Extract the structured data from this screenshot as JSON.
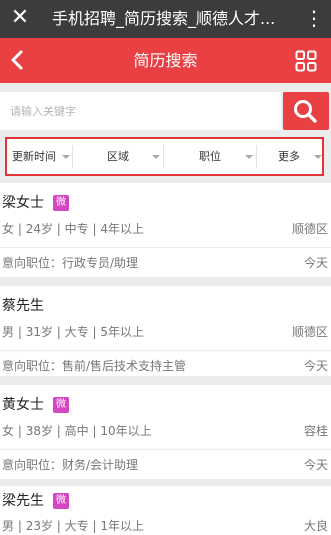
{
  "titlebar": {
    "close_icon": "close-icon",
    "title": "手机招聘_简历搜索_顺德人才...",
    "more_icon": "more-vertical-icon"
  },
  "header": {
    "back_icon": "chevron-left-icon",
    "title": "简历搜索",
    "grid_icon": "grid-icon"
  },
  "search": {
    "placeholder": "请输入关键字",
    "button_icon": "search-icon"
  },
  "filters": [
    {
      "label": "更新时间"
    },
    {
      "label": "区域"
    },
    {
      "label": "职位"
    },
    {
      "label": "更多"
    }
  ],
  "resumes": [
    {
      "name": "梁女士",
      "badge": "微",
      "gender": "女",
      "age": "24岁",
      "education": "中专",
      "experience": "4年以上",
      "location": "顺德区",
      "position": "意向职位：行政专员/助理",
      "updated": "今天"
    },
    {
      "name": "蔡先生",
      "badge": "",
      "gender": "男",
      "age": "31岁",
      "education": "大专",
      "experience": "5年以上",
      "location": "顺德区",
      "position": "意向职位：售前/售后技术支持主管",
      "updated": "今天"
    },
    {
      "name": "黄女士",
      "badge": "微",
      "gender": "女",
      "age": "38岁",
      "education": "高中",
      "experience": "10年以上",
      "location": "容桂",
      "position": "意向职位：财务/会计助理",
      "updated": "今天"
    },
    {
      "name": "梁先生",
      "badge": "微",
      "gender": "男",
      "age": "23岁",
      "education": "大专",
      "experience": "1年以上",
      "location": "大良",
      "position": "",
      "updated": ""
    }
  ],
  "colors": {
    "accent": "#e84043",
    "titlebar": "#3c3c3c",
    "badge": "#d646c2",
    "filter_border": "#e23336"
  }
}
